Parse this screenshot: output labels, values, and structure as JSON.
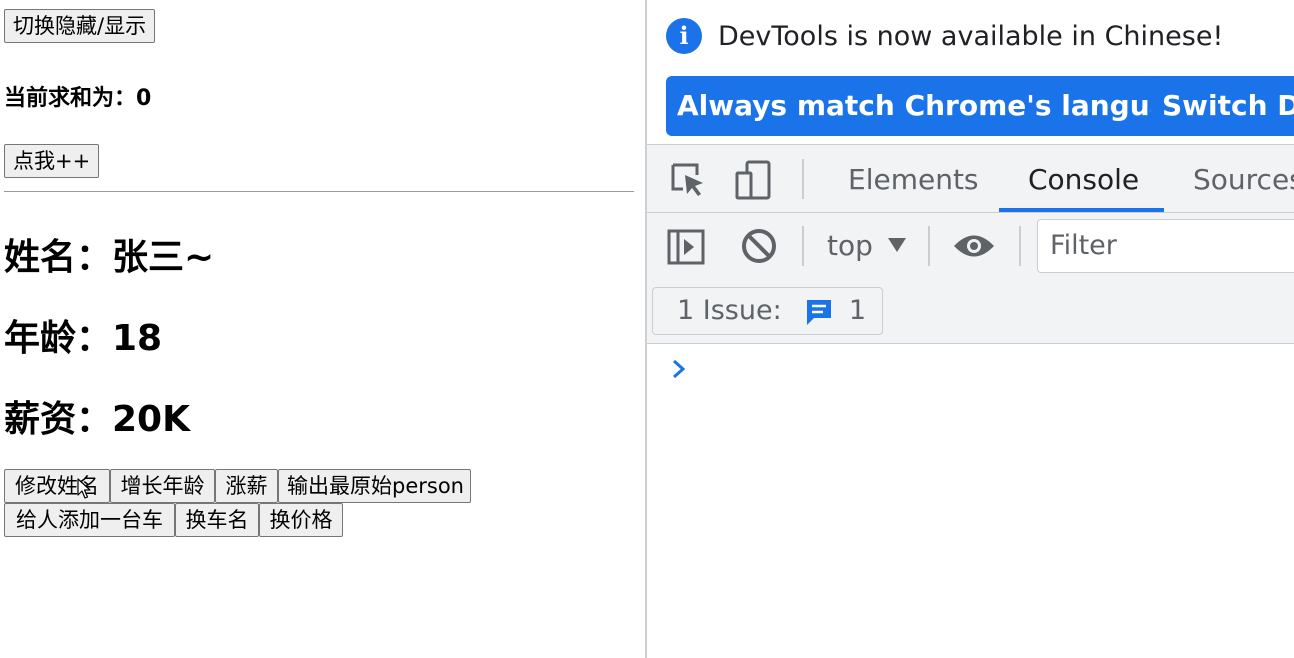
{
  "page": {
    "toggle_button": "切换隐藏/显示",
    "sum_text": "当前求和为：0",
    "increment_button": "点我++",
    "name_heading": "姓名：张三~",
    "age_heading": "年龄：18",
    "salary_heading": "薪资：20K",
    "buttons_row1": [
      "修改姓名",
      "增长年龄",
      "涨薪",
      "输出最原始person"
    ],
    "buttons_row2": [
      "给人添加一台车",
      "换车名",
      "换价格"
    ]
  },
  "devtools": {
    "banner_text": "DevTools is now available in Chinese!",
    "banner_buttons": [
      "Always match Chrome's language",
      "Switch De"
    ],
    "tabs": [
      "Elements",
      "Console",
      "Sources"
    ],
    "active_tab": "Console",
    "context": "top",
    "filter_placeholder": "Filter",
    "issues_label": "1 Issue:",
    "issues_count": "1",
    "accent_color": "#1a73e8"
  }
}
